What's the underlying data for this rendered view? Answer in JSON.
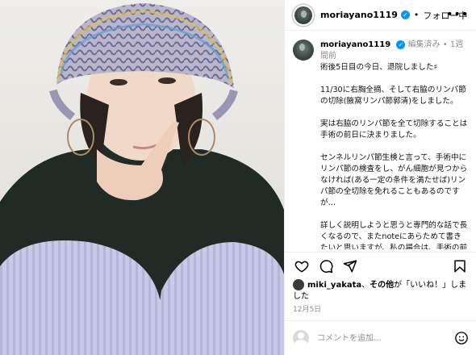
{
  "post": {
    "username": "moriayano1119",
    "verified_mark": "✓",
    "separator": "•",
    "follow_status": "フォロー中",
    "more_icon": "more-horizontal-icon"
  },
  "caption": {
    "username": "moriayano1119",
    "edited": "編集済み",
    "separator": "•",
    "age": "1週間前",
    "text": "術後5日目の今日、退院しました♯\n\n11/30に右胸全摘、そして右脇のリンパ節の切除(腋窩リンパ節郭清)をしました。\n\n実は右脇のリンパ節を全て切除することは手術の前日に決まりました。\n\nセンネルリンパ節生検と言って、手術中にリンパ節の検査をし、がん細胞が見つからなければ(ある一定の条件を満たせば)リンパ節の全切除を免れることもあるのですが…\n\n詳しく説明しようと思うと専門的な話で長くなるので、またnoteにあらためて書きたいと思いますが、私の場合は、手術の前日の段階でリンパ節を全"
  },
  "actions": {
    "like_icon": "heart-icon",
    "comment_icon": "comment-icon",
    "share_icon": "send-icon",
    "save_icon": "bookmark-icon"
  },
  "likes": {
    "user": "miki_yakata",
    "connector": "、",
    "others": "その他",
    "suffix": "が「いいね！」しました"
  },
  "date": "12月5日",
  "composer": {
    "placeholder": "コメントを追加...",
    "emoji_icon": "emoji-smile-icon"
  },
  "colors": {
    "verified": "#0095f6",
    "muted": "#8e8e8e",
    "border": "#efefef"
  }
}
